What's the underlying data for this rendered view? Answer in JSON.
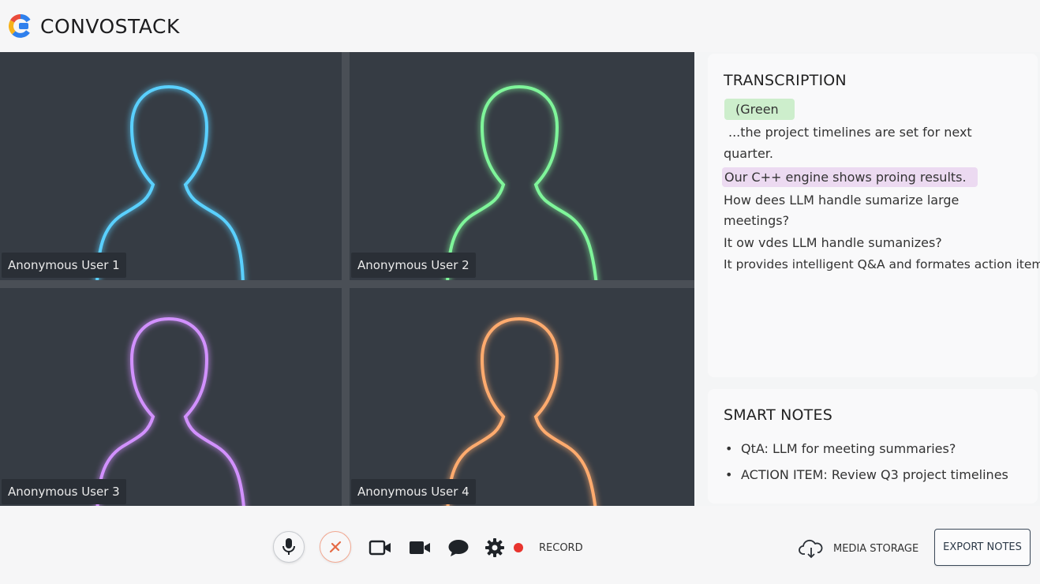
{
  "app": {
    "title": "CONVOSTACK",
    "brand_colors": [
      "#e94b3c",
      "#f6b21b",
      "#2f80ed"
    ]
  },
  "participants": [
    {
      "name": "Anonymous User 1",
      "outline_color": "#5ad0ff"
    },
    {
      "name": "Anonymous User 2",
      "outline_color": "#7ff59a"
    },
    {
      "name": "Anonymous User 3",
      "outline_color": "#d291ff"
    },
    {
      "name": "Anonymous User 4",
      "outline_color": "#ffab6e"
    }
  ],
  "transcription": {
    "title": "TRANSCRIPTION",
    "lines": [
      "(Green",
      "...the project timelines are set for next",
      "quarter.",
      "Our C++ engine shows proing results.",
      "How dees LLM handle sumarize large",
      "meetings?",
      "It ow vdes LLM handle sumanizes?",
      "It provides intelligent Q&A and formates action items"
    ]
  },
  "smart_notes": {
    "title": "SMART NOTES",
    "items": [
      "QtA: LLM for meeting summaries?",
      "ACTION ITEM: Review Q3 project timelines"
    ]
  },
  "toolbar": {
    "icons": [
      "microphone-icon",
      "mute-icon",
      "camera-icon",
      "video-icon",
      "chat-icon",
      "gear-icon",
      "record-dot-icon"
    ],
    "record_label": "RECORD",
    "media_storage_label": "MEDIA STORAGE",
    "export_label": "EXPORT NOTES"
  }
}
